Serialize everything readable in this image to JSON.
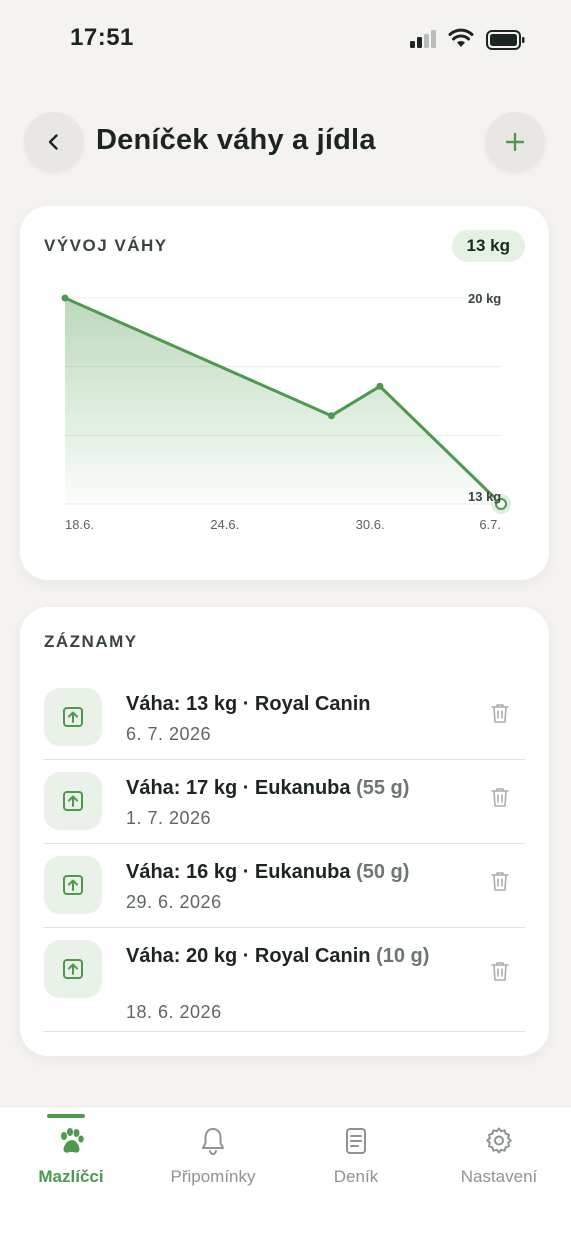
{
  "status_bar": {
    "time": "17:51"
  },
  "header": {
    "title": "Deníček váhy a jídla"
  },
  "chart_card": {
    "heading": "VÝVOJ VÁHY",
    "current_badge": "13 kg"
  },
  "chart_data": {
    "type": "area",
    "categories": [
      "18.6.",
      "24.6.",
      "30.6.",
      "6.7."
    ],
    "series": [
      {
        "points": [
          {
            "x": "18.6.",
            "y": 20
          },
          {
            "x": "29.6.",
            "y": 16
          },
          {
            "x": "1.7.",
            "y": 17
          },
          {
            "x": "6.7.",
            "y": 13
          }
        ]
      }
    ],
    "ylim": [
      13,
      20
    ],
    "y_max_label": "20 kg",
    "y_min_label": "13 kg",
    "grid": true,
    "color": "#4d9a4f"
  },
  "list_card": {
    "heading": "ZÁZNAMY",
    "entries": [
      {
        "title": "Váha: 13 kg · Royal Canin",
        "portion": "",
        "date": "6. 7. 2026"
      },
      {
        "title": "Váha: 17 kg · Eukanuba",
        "portion": "(55 g)",
        "date": "1. 7. 2026"
      },
      {
        "title": "Váha: 16 kg · Eukanuba",
        "portion": "(50 g)",
        "date": "29. 6. 2026"
      },
      {
        "title": "Váha: 20 kg · Royal Canin",
        "portion": "(10 g)",
        "date": "18. 6. 2026"
      }
    ]
  },
  "tabs": [
    {
      "label": "Mazlíčci",
      "icon": "paw-icon",
      "active": true
    },
    {
      "label": "Připomínky",
      "icon": "bell-icon",
      "active": false
    },
    {
      "label": "Deník",
      "icon": "document-icon",
      "active": false
    },
    {
      "label": "Nastavení",
      "icon": "gear-icon",
      "active": false
    }
  ],
  "colors": {
    "accent": "#4d9a4f",
    "background": "#f5f3f0",
    "badge": "#e5f1e3"
  }
}
